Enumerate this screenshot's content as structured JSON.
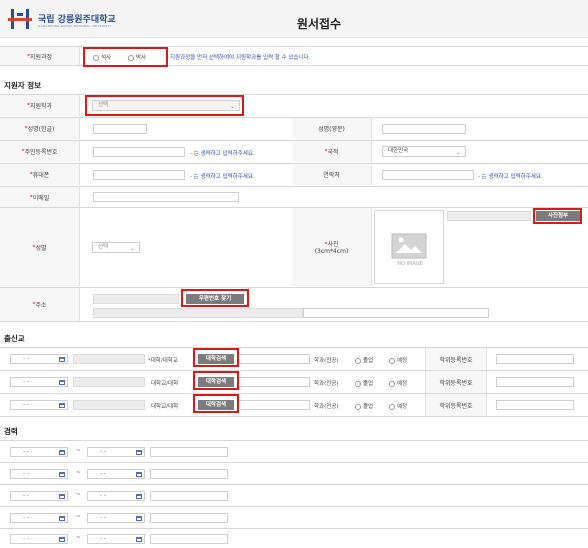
{
  "header": {
    "university_ko": "국립 강릉원주대학교",
    "university_en": "GANGNEUNG-WONJU NATIONAL UNIVERSITY",
    "page_title": "원서접수"
  },
  "course": {
    "label": "지원과정",
    "options": [
      "석사",
      "박사"
    ],
    "hint": "지원과정을 먼저 선택하여야 지원학과를 입력 할 수 있습니다."
  },
  "applicant": {
    "section_title": "지원자 정보",
    "dept_label": "지원학과",
    "dept_selected": "선택",
    "name_ko_label": "성명(한글)",
    "name_en_label": "성명(영문)",
    "rrn_label": "주민등록번호",
    "rrn_hint": "- 는 생략하고 입력하주세요.",
    "nationality_label": "국적",
    "nationality_value": "대한민국",
    "mobile_label": "휴대폰",
    "mobile_hint": "- 는 생략하고 입력하주세요.",
    "contact_label": "연락처",
    "contact_hint": "- 는 생략하고 입력하주세요.",
    "email_label": "이메일",
    "gender_label": "성별",
    "gender_selected": "선택",
    "photo_label": "사진",
    "photo_size": "(3cm*4cm)",
    "no_image_text": "NO IMAGE",
    "photo_button": "사진첨부",
    "address_label": "주소",
    "zipcode_button": "우편번호 찾기"
  },
  "education": {
    "section_title": "출신교",
    "rows": [
      {
        "date": "- -",
        "school_label": "대학/대학교",
        "search_button": "대학검색",
        "major_label": "학과(전공)",
        "grad": "졸업",
        "expected": "예정",
        "degree_label": "학위등록번호"
      },
      {
        "date": "- -",
        "school_label": "대학교/대학",
        "search_button": "대학검색",
        "major_label": "학과(전공)",
        "grad": "졸업",
        "expected": "예정",
        "degree_label": "학위등록번호"
      },
      {
        "date": "- -",
        "school_label": "대학교/대학",
        "search_button": "대학검색",
        "major_label": "학과(전공)",
        "grad": "졸업",
        "expected": "예정",
        "degree_label": "학위등록번호"
      }
    ]
  },
  "career": {
    "section_title": "경력",
    "rows": [
      {
        "start": "- -",
        "end": "- -"
      },
      {
        "start": "- -",
        "end": "- -"
      },
      {
        "start": "- -",
        "end": "- -"
      },
      {
        "start": "- -",
        "end": "- -"
      },
      {
        "start": "- -",
        "end": "- -"
      }
    ],
    "separator": "~"
  }
}
